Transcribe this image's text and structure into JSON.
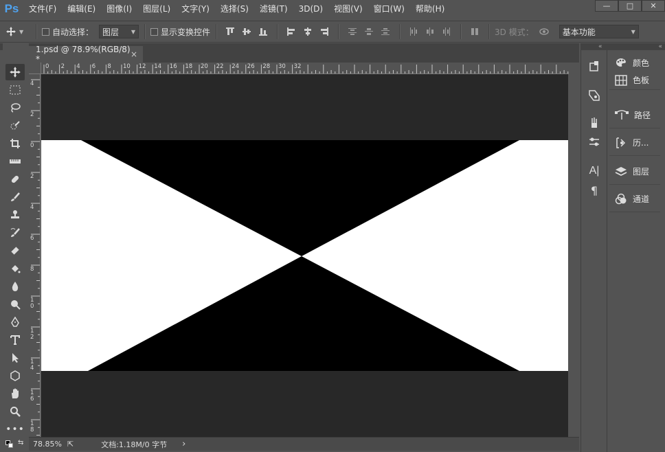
{
  "app": {
    "logo": "Ps"
  },
  "menu": [
    "文件(F)",
    "编辑(E)",
    "图像(I)",
    "图层(L)",
    "文字(Y)",
    "选择(S)",
    "滤镜(T)",
    "3D(D)",
    "视图(V)",
    "窗口(W)",
    "帮助(H)"
  ],
  "options": {
    "auto_select_label": "自动选择：",
    "auto_select_target": "图层",
    "show_transform_label": "显示变换控件",
    "mode_3d_label": "3D 模式：",
    "workspace": "基本功能"
  },
  "document": {
    "tab_title": "1.psd @ 78.9%(RGB/8) *",
    "close": "×"
  },
  "ruler": {
    "top": [
      "0",
      "2",
      "4",
      "6",
      "8",
      "10",
      "12",
      "14",
      "16",
      "18",
      "20",
      "22",
      "24",
      "26",
      "28",
      "30",
      "32"
    ],
    "left": [
      "4",
      "2",
      "0",
      "2",
      "4",
      "6",
      "8",
      "1 0",
      "1 2",
      "1 4",
      "1 6",
      "1 8"
    ]
  },
  "status": {
    "zoom": "78.85%",
    "doc_info": "文档:1.18M/0 字节",
    "arrow": "›"
  },
  "panels": {
    "color": "颜色",
    "swatches": "色板",
    "paths": "路径",
    "history": "历...",
    "layers": "图层",
    "channels": "通道"
  },
  "colors": {
    "foreground": "#000000",
    "background": "#ffffff",
    "workspace_bg": "#282828"
  }
}
